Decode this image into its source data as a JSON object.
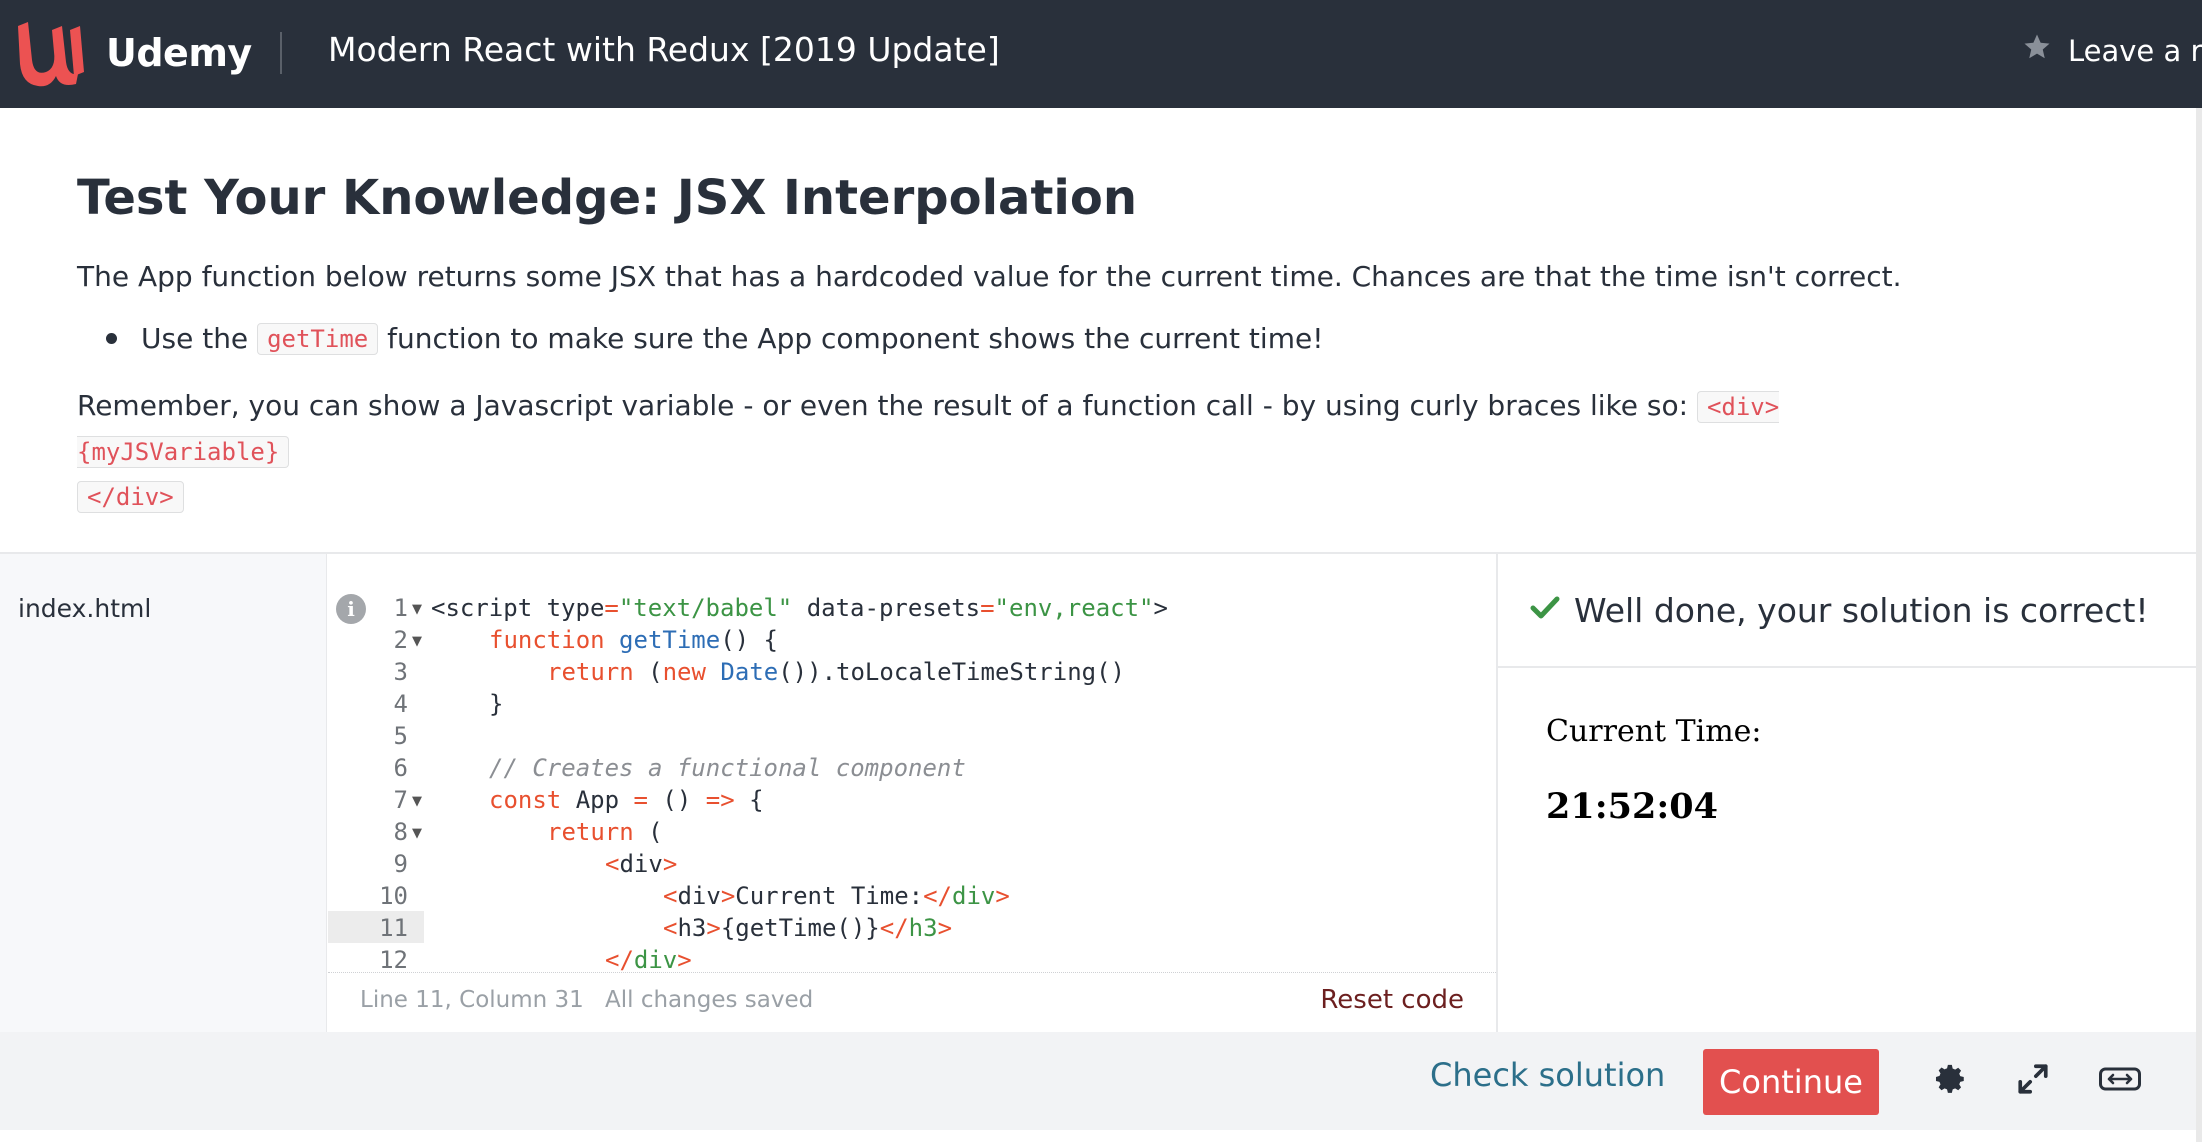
{
  "header": {
    "brand": "Udemy",
    "course_title": "Modern React with Redux [2019 Update]",
    "rating_label": "Leave a ra"
  },
  "quiz": {
    "title": "Test Your Knowledge: JSX Interpolation",
    "intro": "The App function below returns some JSX that has a hardcoded value for the current time.  Chances are that the time isn't correct.",
    "bullet_before": "Use the",
    "bullet_code": "getTime",
    "bullet_after": "function to make sure the App component shows the current time!",
    "remember_text": "Remember, you can show a Javascript variable - or even the result of a function call - by using curly braces like so:",
    "remember_code_1": "<div>{myJSVariable}",
    "remember_code_2": "</div>"
  },
  "editor": {
    "file_name": "index.html",
    "line_numbers": [
      "1",
      "2",
      "3",
      "4",
      "5",
      "6",
      "7",
      "8",
      "9",
      "10",
      "11",
      "12"
    ],
    "code": {
      "l1_a": "<script",
      "l1_b": " type",
      "l1_c": "=",
      "l1_d": "\"text/babel\"",
      "l1_e": " data-presets",
      "l1_f": "=",
      "l1_g": "\"env,react\"",
      "l1_h": ">",
      "l2_a": "function",
      "l2_b": " getTime",
      "l2_c": "() {",
      "l3_a": "return",
      "l3_b": " (",
      "l3_c": "new",
      "l3_d": " Date",
      "l3_e": "()).toLocaleTimeString()",
      "l4": "}",
      "l6": "// Creates a functional component",
      "l7_a": "const",
      "l7_b": " App ",
      "l7_c": "=",
      "l7_d": " () ",
      "l7_e": "=>",
      "l7_f": " {",
      "l8_a": "return",
      "l8_b": " (",
      "l9_a": "<",
      "l9_b": "div",
      "l9_c": ">",
      "l10_a": "<",
      "l10_b": "div",
      "l10_c": ">",
      "l10_d": "Current Time:",
      "l10_e": "</",
      "l10_f": "div",
      "l10_g": ">",
      "l11_a": "<",
      "l11_b": "h3",
      "l11_c": ">",
      "l11_d": "{getTime()}",
      "l11_e": "</",
      "l11_f": "h3",
      "l11_g": ">",
      "l12_a": "</",
      "l12_b": "div",
      "l12_c": ">"
    },
    "status_position": "Line 11, Column 31",
    "status_saved": "All changes saved",
    "reset_label": "Reset code"
  },
  "result": {
    "message": "Well done, your solution is correct!",
    "preview_label": "Current Time:",
    "preview_time": "21:52:04"
  },
  "footer": {
    "check_solution_label": "Check solution",
    "continue_label": "Continue"
  },
  "icons": {
    "logo": "udemy-logo",
    "star": "star-icon",
    "info": "info-icon",
    "check": "check-icon",
    "settings": "gear-icon",
    "fullscreen": "expand-icon",
    "width": "expand-width-icon"
  },
  "colors": {
    "header_bg": "#29303b",
    "brand_red": "#ec5252",
    "continue_bg": "#e2504f",
    "check_green": "#3c9445",
    "link_blue": "#2c6f8a"
  }
}
